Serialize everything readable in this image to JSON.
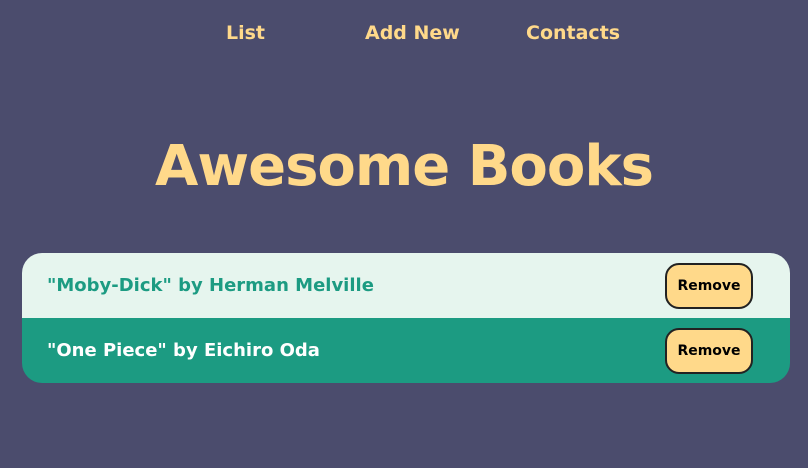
{
  "nav": {
    "items": [
      {
        "label": "List"
      },
      {
        "label": "Add New"
      },
      {
        "label": "Contacts"
      }
    ]
  },
  "page": {
    "title": "Awesome Books"
  },
  "books": [
    {
      "text": "\"Moby-Dick\" by Herman Melville",
      "remove_label": "Remove"
    },
    {
      "text": "\"One Piece\" by Eichiro Oda",
      "remove_label": "Remove"
    }
  ],
  "colors": {
    "background": "#4b4c6d",
    "accent": "#ffd98a",
    "row_light": "#e6f5ee",
    "row_dark": "#1c9b82"
  }
}
